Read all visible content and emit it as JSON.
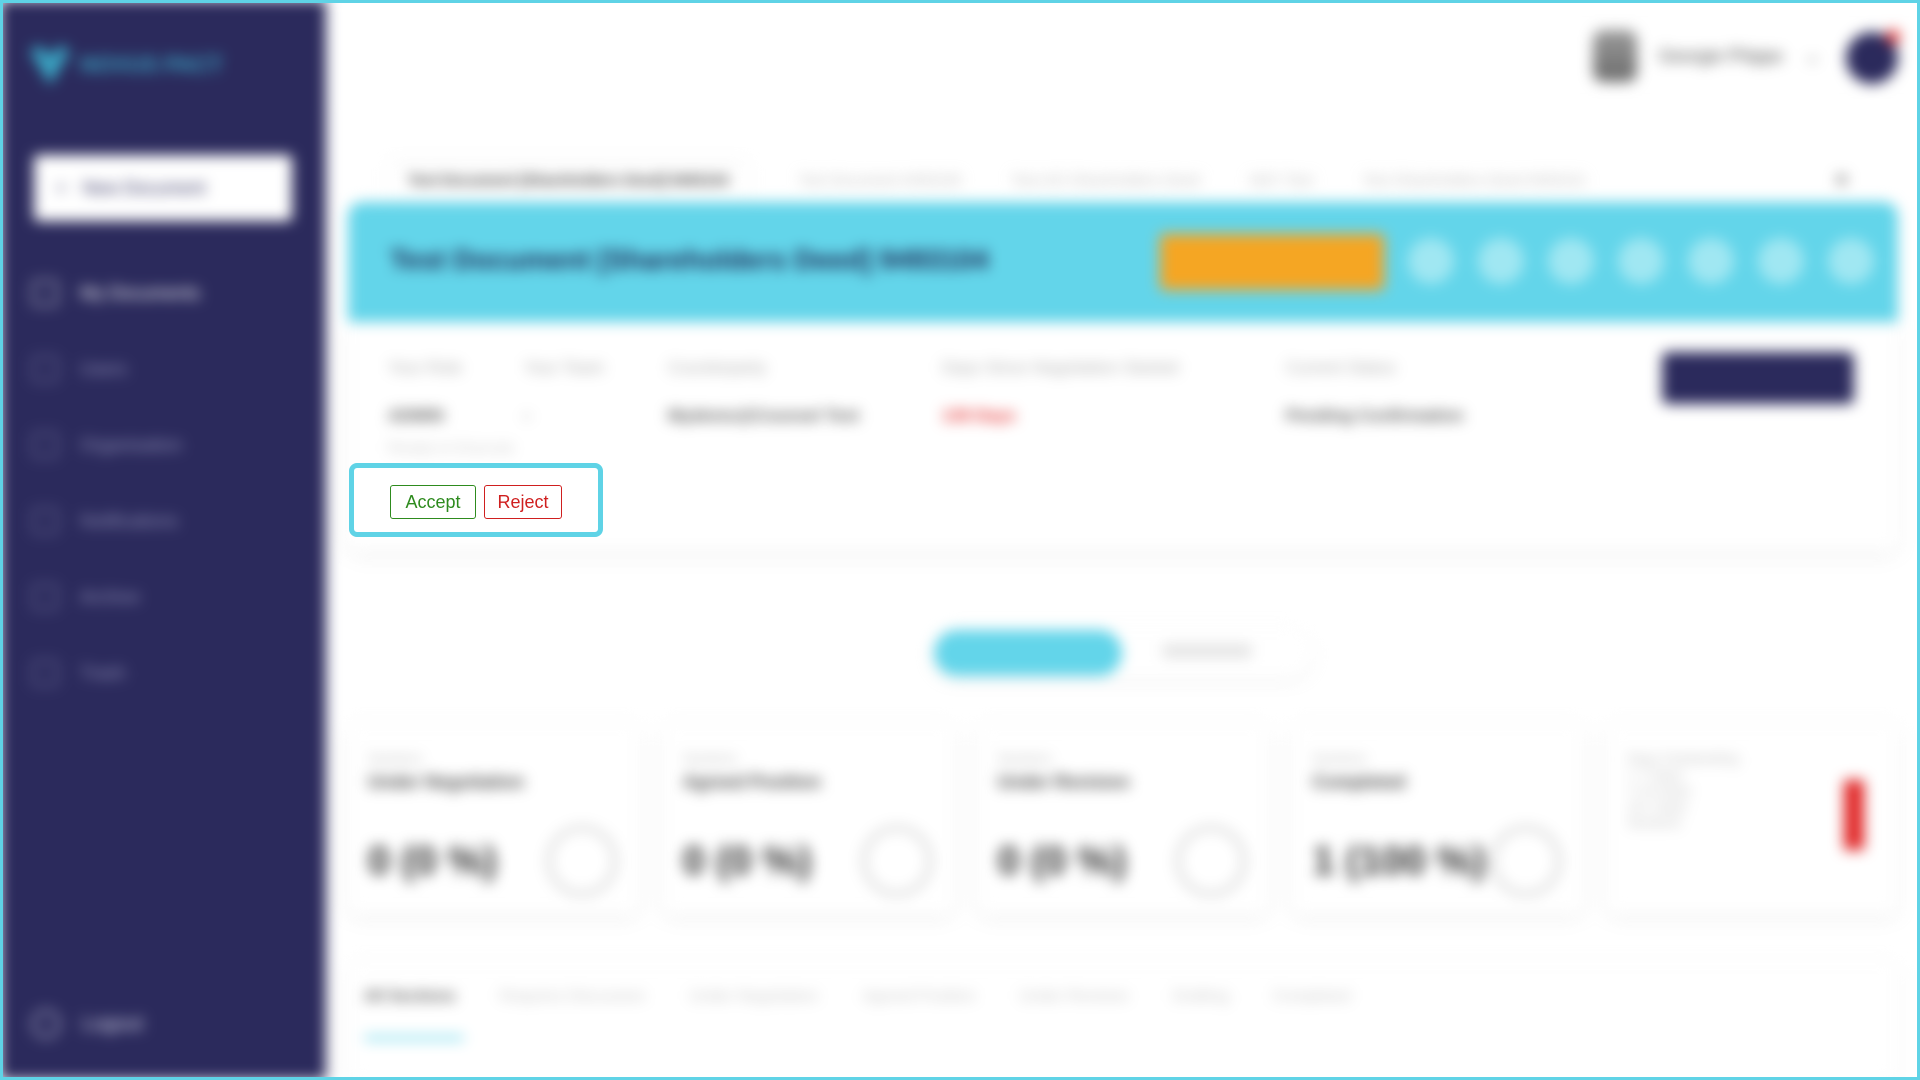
{
  "app": {
    "name": "NOVUS PACT"
  },
  "sidebar": {
    "new_document": "New Document",
    "items": [
      {
        "label": "My Documents"
      },
      {
        "label": "Users"
      },
      {
        "label": "Organisation"
      },
      {
        "label": "Notifications"
      },
      {
        "label": "Archive"
      },
      {
        "label": "Trash"
      }
    ],
    "logout": "Logout"
  },
  "header": {
    "user_name": "Georgie Phipps"
  },
  "doc_tabs": [
    "Test Document [Shareholders Deed] 9493104",
    "Test Document 9493105",
    "Test A/S Shareholders Deed",
    "NDY Test",
    "Test Shareholders Deed 9493101"
  ],
  "banner": {
    "title": "Test Document [Shareholders Deed] 9493104"
  },
  "info": {
    "your_role_label": "Your Role",
    "your_role": "ADMIN",
    "your_team_label": "Your Team",
    "your_team": "-",
    "counterparty_label": "Counterparty",
    "counterparty": "Mydemo@Counsel Test",
    "days_label": "Days Since Negotiation Started",
    "days": "139 Days",
    "status_label": "Current Status",
    "status": "Pending Confirmation",
    "ready_label": "Ready to Execute"
  },
  "actions": {
    "accept": "Accept",
    "reject": "Reject"
  },
  "toggle": {
    "active": "My Sections",
    "inactive": "All Sections"
  },
  "cards": [
    {
      "label": "Sections",
      "title": "Under Negotiation",
      "value": "0 (0 %)",
      "icon": "handshake-icon"
    },
    {
      "label": "Sections",
      "title": "Agreed Position",
      "value": "0 (0 %)",
      "icon": "thumbs-up-icon"
    },
    {
      "label": "Sections",
      "title": "Under Revision",
      "value": "0 (0 %)",
      "icon": "edit-circle-icon"
    },
    {
      "label": "Sections",
      "title": "Completed",
      "value": "1 (100 %)",
      "icon": "check-circle-icon"
    }
  ],
  "days_outstanding": {
    "title": "Days Outstanding",
    "legend": [
      "< 7 Days",
      "7-14 Days",
      "14+ Days"
    ],
    "colors": [
      "#2fa83a",
      "#f5c023",
      "#e02424"
    ],
    "xlabel": "Sections"
  },
  "bottom_tabs": [
    "All Sections",
    "Requires Discussion",
    "Under Negotiation",
    "Agreed Position",
    "Under Revision",
    "Drafting",
    "Completed"
  ]
}
